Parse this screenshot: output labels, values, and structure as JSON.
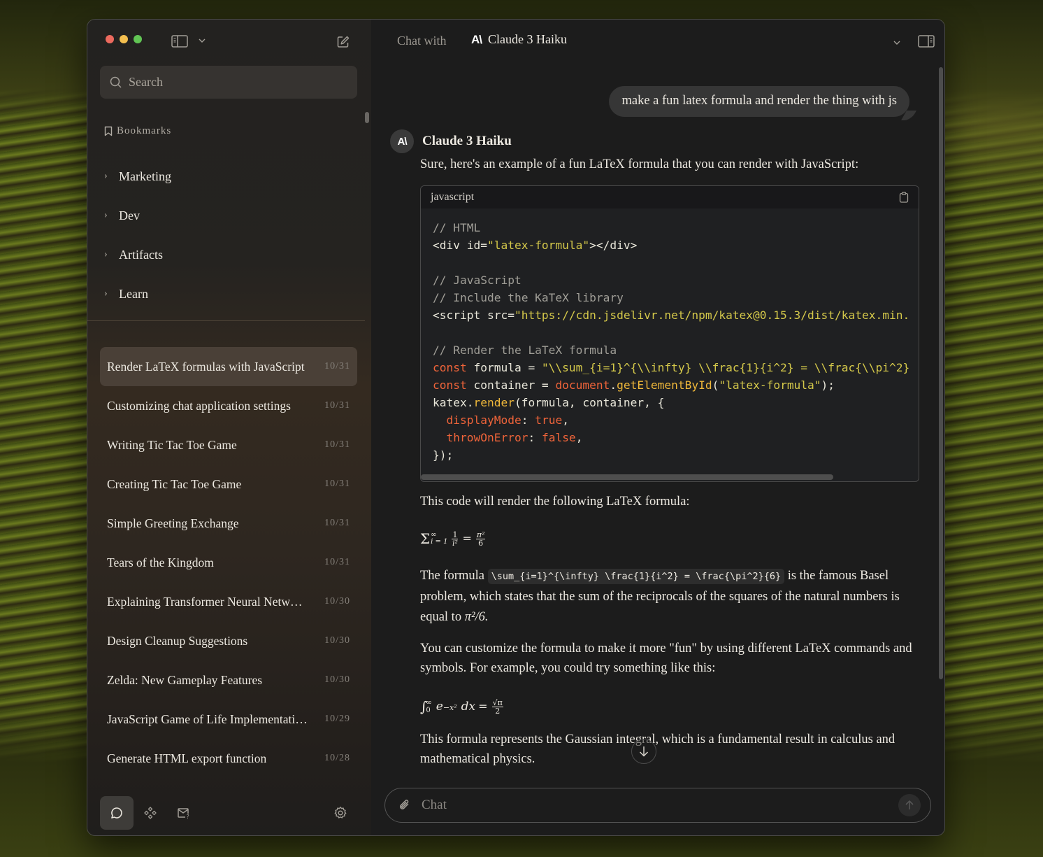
{
  "sidebar": {
    "search_placeholder": "Search",
    "bookmarks_label": "Bookmarks",
    "folders": [
      {
        "label": "Marketing"
      },
      {
        "label": "Dev"
      },
      {
        "label": "Artifacts"
      },
      {
        "label": "Learn"
      }
    ],
    "chats": [
      {
        "title": "Render LaTeX formulas with JavaScript",
        "date": "10/31",
        "active": true
      },
      {
        "title": "Customizing chat application settings",
        "date": "10/31"
      },
      {
        "title": "Writing Tic Tac Toe Game",
        "date": "10/31"
      },
      {
        "title": "Creating Tic Tac Toe Game",
        "date": "10/31"
      },
      {
        "title": "Simple Greeting Exchange",
        "date": "10/31"
      },
      {
        "title": "Tears of the Kingdom",
        "date": "10/31"
      },
      {
        "title": "Explaining Transformer Neural Netw…",
        "date": "10/30"
      },
      {
        "title": "Design Cleanup Suggestions",
        "date": "10/30"
      },
      {
        "title": "Zelda: New Gameplay Features",
        "date": "10/30"
      },
      {
        "title": "JavaScript Game of Life Implementati…",
        "date": "10/29"
      },
      {
        "title": "Generate HTML export function",
        "date": "10/28"
      }
    ],
    "bottom_icons": [
      "chat-icon",
      "prompts-icon",
      "feedback-mail-icon",
      "settings-icon"
    ]
  },
  "header": {
    "chat_with_label": "Chat with",
    "model_logo": "A\\",
    "model_name": "Claude 3 Haiku"
  },
  "conversation": {
    "user_message": "make a fun latex formula and render the thing with js",
    "assistant": {
      "avatar": "A\\",
      "name": "Claude 3 Haiku",
      "intro": "Sure, here's an example of a fun LaTeX formula that you can render with JavaScript:",
      "code": {
        "language": "javascript",
        "lines": [
          "// HTML",
          "<div id=\"latex-formula\"></div>",
          "",
          "// JavaScript",
          "// Include the KaTeX library",
          "<script src=\"https://cdn.jsdelivr.net/npm/katex@0.15.3/dist/katex.min.",
          "",
          "// Render the LaTeX formula",
          "const formula = \"\\\\sum_{i=1}^{\\\\infty} \\\\frac{1}{i^2} = \\\\frac{\\\\pi^2}",
          "const container = document.getElementById(\"latex-formula\");",
          "katex.render(formula, container, {",
          "  displayMode: true,",
          "  throwOnError: false,",
          "});"
        ]
      },
      "after_code": "This code will render the following LaTeX formula:",
      "formula1": {
        "sum_sup": "∞",
        "sum_sub": "i = 1",
        "frac_num": "1",
        "frac_den": "i²",
        "rhs_num": "π²",
        "rhs_den": "6"
      },
      "para2_before": "The formula",
      "para2_code": "\\sum_{i=1}^{\\infty} \\frac{1}{i^2} = \\frac{\\pi^2}{6}",
      "para2_after": "is the famous Basel problem, which states that the sum of the reciprocals of the squares of the natural numbers is equal to",
      "para2_end": "π²/6.",
      "para3": "You can customize the formula to make it more \"fun\" by using different LaTeX commands and symbols. For example, you could try something like this:",
      "formula2": {
        "int_sup": "∞",
        "int_sub": "0",
        "integrand": "e",
        "exp": "−x²",
        "dx": "dx",
        "rhs_num": "√π",
        "rhs_den": "2"
      },
      "para4": "This formula represents the Gaussian integral, which is a fundamental result in calculus and mathematical physics."
    }
  },
  "composer": {
    "placeholder": "Chat"
  }
}
